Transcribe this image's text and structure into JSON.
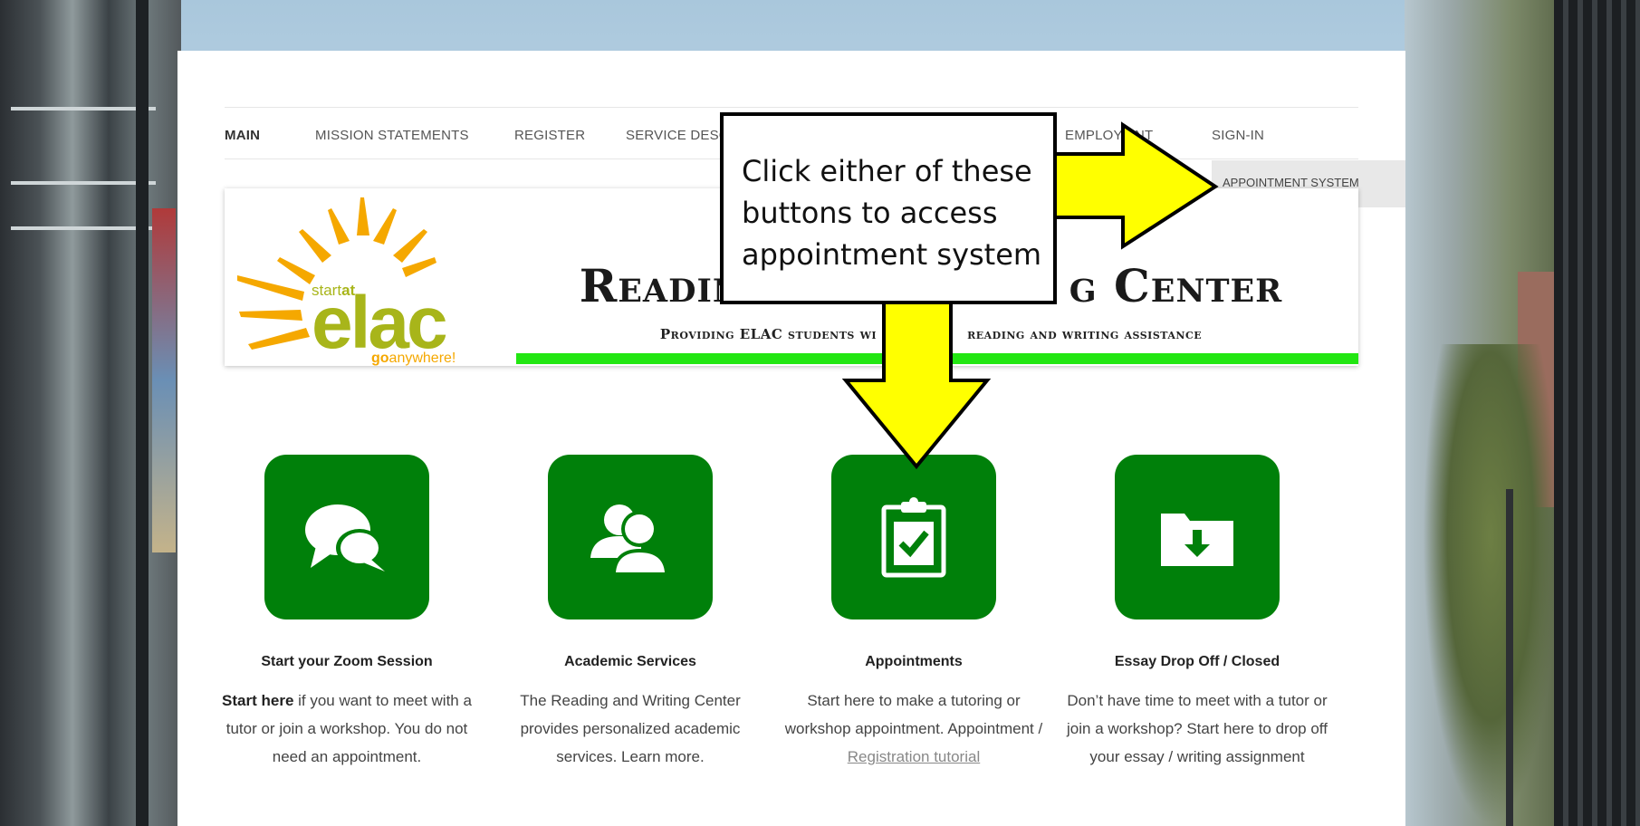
{
  "nav": {
    "items": [
      {
        "label": "MAIN",
        "active": true
      },
      {
        "label": "MISSION STATEMENTS"
      },
      {
        "label": "REGISTER"
      },
      {
        "label": "SERVICE DESC"
      },
      {
        "label": "EMPLOY"
      },
      {
        "label": "NT"
      },
      {
        "label": "SIGN-IN"
      }
    ],
    "submenu_item": "APPOINTMENT SYSTEM"
  },
  "header": {
    "title_part1": "Reading",
    "title_part2": "g Center",
    "tagline_part1": "Providing ELAC students wi",
    "tagline_part2": "reading and writing assistance",
    "logo": {
      "top": "startat",
      "main": "elac",
      "bottom_bold": "go",
      "bottom_rest": "anywhere!"
    }
  },
  "callout": {
    "text": "Click either of these buttons to access appointment system"
  },
  "cards": [
    {
      "icon": "chat-bubbles-icon",
      "title": "Start your Zoom Session",
      "text_bold": "Start here",
      "text": " if you want to meet with a tutor or join a workshop. You do not need an appointment."
    },
    {
      "icon": "users-icon",
      "title": "Academic Services",
      "text": "The Reading and Writing Center provides personalized academic services. Learn more."
    },
    {
      "icon": "clipboard-check-icon",
      "title": "Appointments",
      "text": "Start here to make a tutoring or workshop appointment. Appointment / ",
      "link": "Registration tutorial"
    },
    {
      "icon": "folder-download-icon",
      "title": "Essay Drop Off / Closed",
      "text": "Don’t have time to meet with a tutor or join a workshop? Start here to drop off your essay / writing assignment"
    }
  ],
  "colors": {
    "tile_green": "#00800a",
    "banner_green": "#22e612",
    "arrow_yellow": "#ffff00",
    "sun_orange": "#f5a800",
    "logo_green": "#a8b51a"
  }
}
